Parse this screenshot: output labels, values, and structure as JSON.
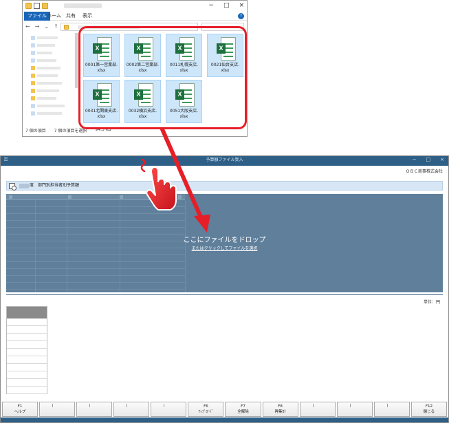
{
  "explorer": {
    "ribbon_tabs": [
      "ファイル",
      "ホーム",
      "共有",
      "表示"
    ],
    "window_controls": [
      "−",
      "□",
      "×"
    ],
    "help_label": "?",
    "files": [
      {
        "line1": "0001第一営業部.",
        "line2": "xlsx"
      },
      {
        "line1": "0002第二営業部.",
        "line2": "xlsx"
      },
      {
        "line1": "0011札幌支店.",
        "line2": "xlsx"
      },
      {
        "line1": "0021仙台支店.",
        "line2": "xlsx"
      },
      {
        "line1": "0031北関東支店.",
        "line2": "xlsx"
      },
      {
        "line1": "0032横浜支店.",
        "line2": "xlsx"
      },
      {
        "line1": "0051大阪支店.",
        "line2": "xlsx"
      }
    ],
    "status": {
      "count": "7 個の項目",
      "selected": "7 個の項目を選択",
      "size": "94.3 KB"
    },
    "icons": {
      "excel_badge": "X"
    }
  },
  "app": {
    "title": "予算額ファイル受入",
    "window_controls": [
      "−",
      "□",
      "×"
    ],
    "company": "ＯＢＣ商事株式会社",
    "header": {
      "title": "度　部門別担当者別予算額"
    },
    "dropzone": {
      "main": "ここにファイルをドロップ",
      "sub": "またはクリックしてファイルを選択"
    },
    "unit": "単位：円",
    "fkeys": [
      {
        "key": "F1",
        "label": "ヘルプ"
      },
      {
        "key": "",
        "label": ""
      },
      {
        "key": "",
        "label": ""
      },
      {
        "key": "",
        "label": ""
      },
      {
        "key": "",
        "label": ""
      },
      {
        "key": "F6",
        "label": "ｱｯﾌﾟﾛｰﾄﾞ"
      },
      {
        "key": "F7",
        "label": "全解除"
      },
      {
        "key": "F8",
        "label": "再集計"
      },
      {
        "key": "",
        "label": ""
      },
      {
        "key": "",
        "label": ""
      },
      {
        "key": "",
        "label": ""
      },
      {
        "key": "F12",
        "label": "閉じる"
      }
    ]
  },
  "colors": {
    "annotation_red": "#e61e28",
    "app_titlebar": "#2e5f86",
    "dropzone": "#5f7f9b",
    "selected_file": "#cde6fa",
    "excel_green": "#1d6f3e"
  }
}
